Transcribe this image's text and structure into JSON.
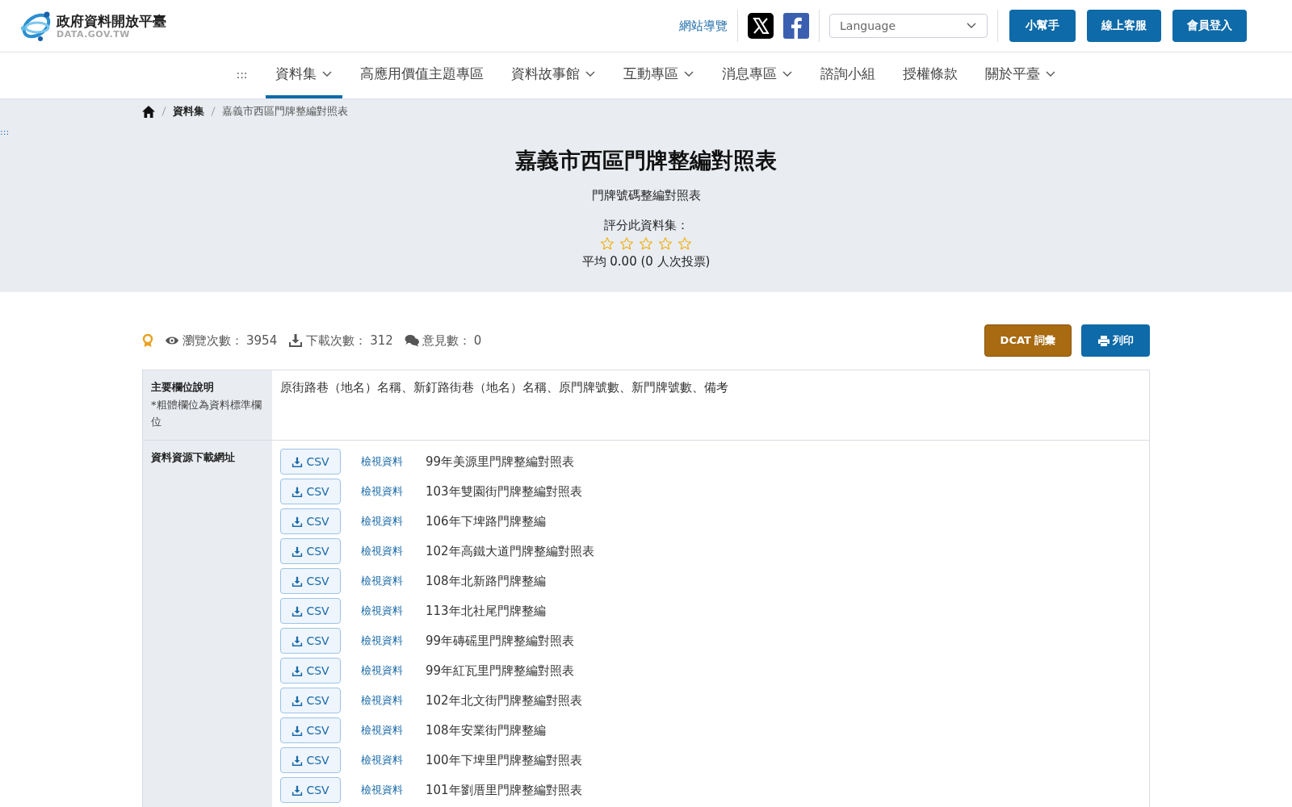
{
  "header": {
    "logo_title": "政府資料開放平臺",
    "logo_subtitle": "DATA.GOV.TW",
    "sitemap_link": "網站導覽",
    "language": {
      "placeholder": "Language"
    },
    "buttons": [
      "小幫手",
      "線上客服",
      "會員登入"
    ]
  },
  "nav": {
    "items": [
      {
        "label": ":::",
        "kind": "anchor",
        "selected": false
      },
      {
        "label": "資料集",
        "kind": "dropdown",
        "selected": true
      },
      {
        "label": "高應用價值主題專區",
        "kind": "link",
        "selected": false
      },
      {
        "label": "資料故事館",
        "kind": "dropdown",
        "selected": false
      },
      {
        "label": "互動專區",
        "kind": "dropdown",
        "selected": false
      },
      {
        "label": "消息專區",
        "kind": "dropdown",
        "selected": false
      },
      {
        "label": "諮詢小組",
        "kind": "link",
        "selected": false
      },
      {
        "label": "授權條款",
        "kind": "link",
        "selected": false
      },
      {
        "label": "關於平臺",
        "kind": "dropdown",
        "selected": false
      }
    ]
  },
  "side_anchor": ":::",
  "breadcrumb": [
    "資料集",
    "嘉義市西區門牌整編對照表"
  ],
  "dataset": {
    "title": "嘉義市西區門牌整編對照表",
    "subtitle": "門牌號碼整編對照表",
    "rate_label": "評分此資料集：",
    "stars": 0,
    "average": "平均 0.00 (0 人次投票)"
  },
  "stats": [
    {
      "kind": "views",
      "label": "瀏覽次數：",
      "value": "3954"
    },
    {
      "kind": "downloads",
      "label": "下載次數：",
      "value": "312"
    },
    {
      "kind": "comments",
      "label": "意見數：",
      "value": "0"
    }
  ],
  "actions": [
    {
      "kind": "dcat",
      "label": "DCAT 詞彙"
    },
    {
      "kind": "print",
      "label": "列印"
    }
  ],
  "fields": {
    "label": "主要欄位說明",
    "note": "*粗體欄位為資料標準欄位",
    "value": "原街路巷（地名）名稱、新釘路街巷（地名）名稱、原門牌號數、新門牌號數、備考"
  },
  "resources": {
    "label": "資料資源下載網址",
    "rows": [
      {
        "format": "CSV",
        "view": "檢視資料",
        "name": "99年美源里門牌整編對照表"
      },
      {
        "format": "CSV",
        "view": "檢視資料",
        "name": "103年雙園街門牌整編對照表"
      },
      {
        "format": "CSV",
        "view": "檢視資料",
        "name": "106年下埤路門牌整編"
      },
      {
        "format": "CSV",
        "view": "檢視資料",
        "name": "102年高鐵大道門牌整編對照表"
      },
      {
        "format": "CSV",
        "view": "檢視資料",
        "name": "108年北新路門牌整編"
      },
      {
        "format": "CSV",
        "view": "檢視資料",
        "name": "113年北社尾門牌整編"
      },
      {
        "format": "CSV",
        "view": "檢視資料",
        "name": "99年磚磘里門牌整編對照表"
      },
      {
        "format": "CSV",
        "view": "檢視資料",
        "name": "99年紅瓦里門牌整編對照表"
      },
      {
        "format": "CSV",
        "view": "檢視資料",
        "name": "102年北文街門牌整編對照表"
      },
      {
        "format": "CSV",
        "view": "檢視資料",
        "name": "108年安業街門牌整編"
      },
      {
        "format": "CSV",
        "view": "檢視資料",
        "name": "100年下埤里門牌整編對照表"
      },
      {
        "format": "CSV",
        "view": "檢視資料",
        "name": "101年劉厝里門牌整編對照表"
      }
    ]
  }
}
